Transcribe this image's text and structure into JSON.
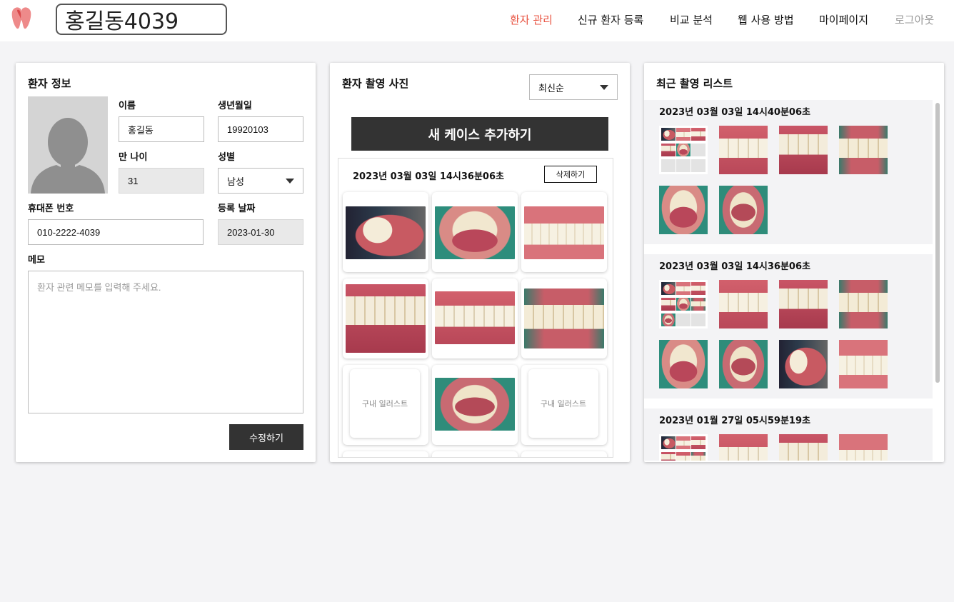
{
  "header": {
    "patient_name": "홍길동4039",
    "nav": {
      "patient_mgmt": "환자 관리",
      "new_patient": "신규 환자 등록",
      "compare": "비교 분석",
      "how_to": "웹 사용 방법",
      "mypage": "마이페이지",
      "logout": "로그아웃"
    },
    "active_color": "#e8513f"
  },
  "patient_info": {
    "title": "환자 정보",
    "name_label": "이름",
    "name": "홍길동",
    "birth_label": "생년월일",
    "birth": "19920103",
    "age_label": "만 나이",
    "age": "31",
    "gender_label": "성별",
    "gender": "남성",
    "phone_label": "휴대폰 번호",
    "phone": "010-2222-4039",
    "reg_label": "등록 날짜",
    "reg_date": "2023-01-30",
    "memo_label": "메모",
    "memo_placeholder": "환자 관련 메모를 입력해 주세요.",
    "edit_button": "수정하기"
  },
  "photos": {
    "title": "환자 촬영 사진",
    "sort": "최신순",
    "add_case": "새 케이스 추가하기",
    "case_date": "2023년 03월 03일 14시36분06초",
    "delete": "삭제하기",
    "illustration_label": "구내 일러스트"
  },
  "recent": {
    "title": "최근 촬영 리스트",
    "blocks": [
      {
        "date": "2023년 03월 03일 14시40분06초"
      },
      {
        "date": "2023년 03월 03일 14시36분06초"
      },
      {
        "date": "2023년 01월 27일 05시59분19초"
      }
    ]
  }
}
